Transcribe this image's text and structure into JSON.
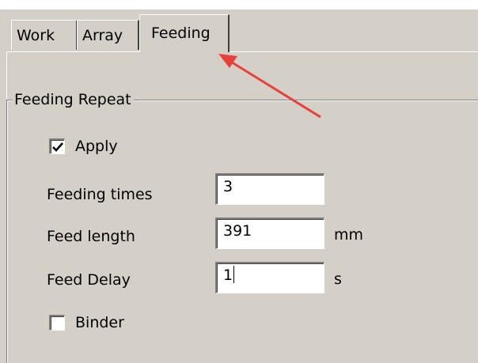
{
  "tabs": [
    {
      "label": "Work",
      "active": false
    },
    {
      "label": "Array",
      "active": false
    },
    {
      "label": "Feeding",
      "active": true
    }
  ],
  "group": {
    "title": "Feeding Repeat"
  },
  "apply_checkbox": {
    "label": "Apply",
    "checked": true
  },
  "fields": {
    "feeding_times": {
      "label": "Feeding times",
      "value": "3"
    },
    "feed_length": {
      "label": "Feed length",
      "value": "391",
      "unit": "mm"
    },
    "feed_delay": {
      "label": "Feed Delay",
      "value": "1",
      "unit": "s"
    }
  },
  "binder_checkbox": {
    "label": "Binder",
    "checked": false
  },
  "colors": {
    "panel_bg": "#d4d0c8",
    "annotation_arrow": "#e8413c"
  }
}
